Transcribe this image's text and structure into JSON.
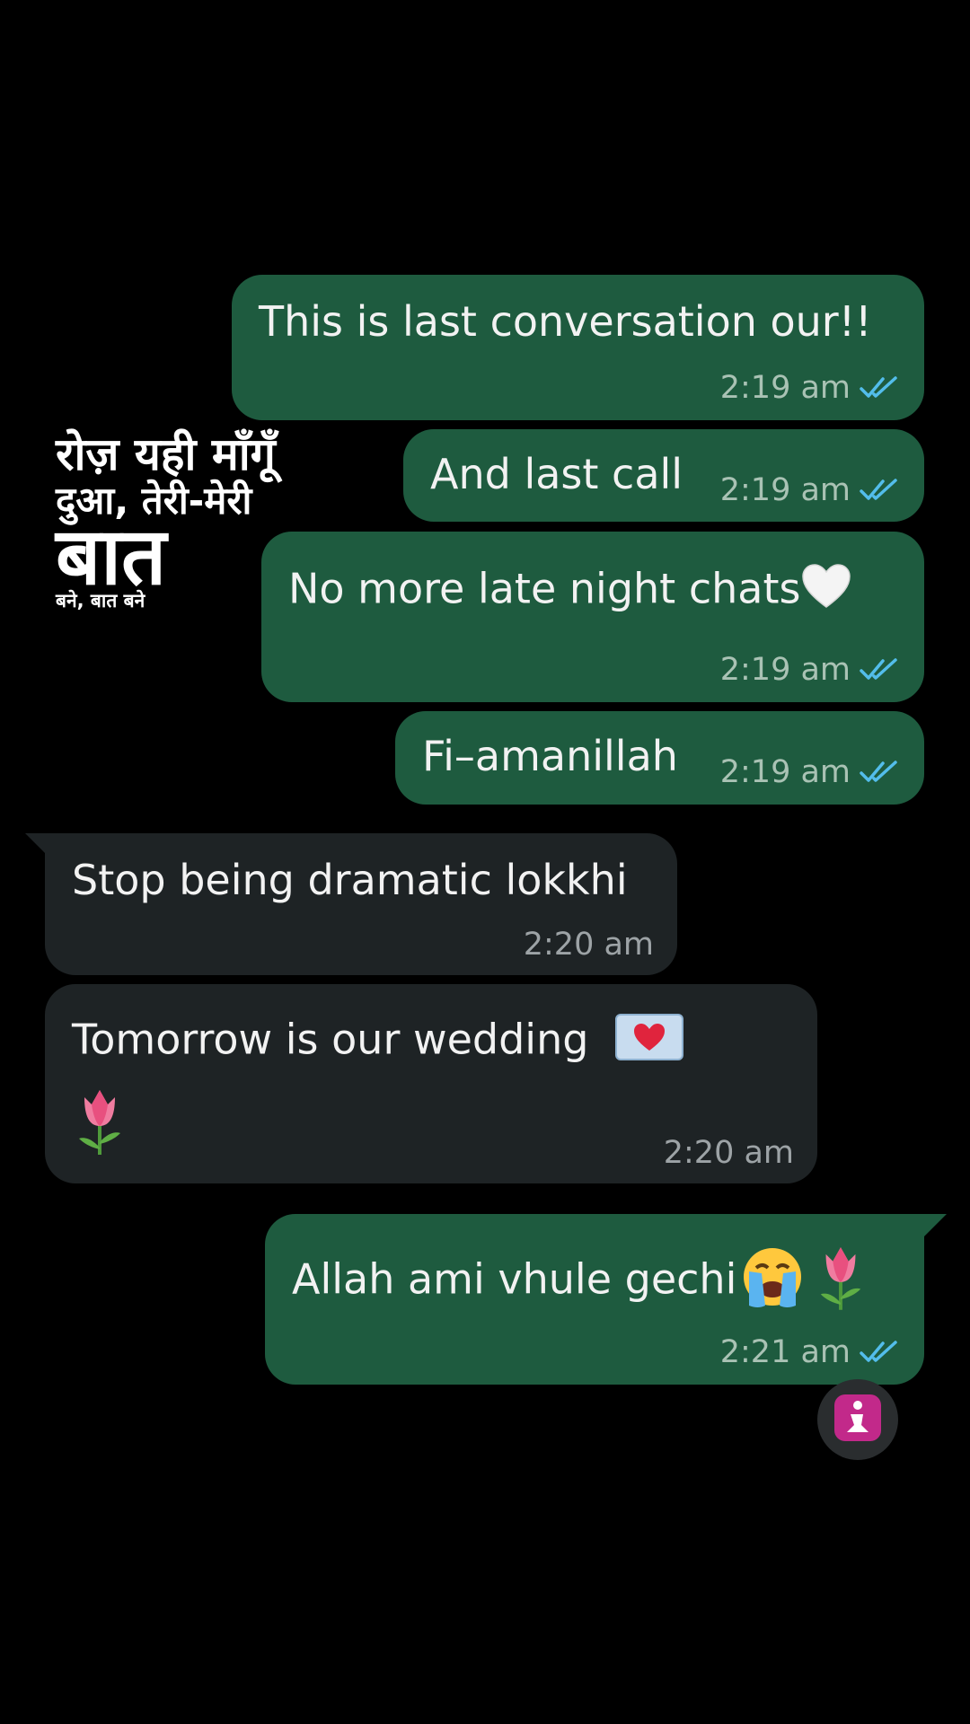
{
  "overlay": {
    "line1": "रोज़ यही माँगूँ",
    "line2": "दुआ, तेरी-मेरी",
    "line3": "बात",
    "line4": "बने, बात बने"
  },
  "messages": [
    {
      "direction": "outgoing",
      "text": "This is last conversation our!!",
      "time": "2:19 am",
      "read": true
    },
    {
      "direction": "outgoing",
      "text": "And last call",
      "time": "2:19 am",
      "read": true
    },
    {
      "direction": "outgoing",
      "text": "No more late night chats",
      "emoji": "white-heart",
      "time": "2:19 am",
      "read": true
    },
    {
      "direction": "outgoing",
      "text": "Fi–amanillah",
      "time": "2:19 am",
      "read": true
    },
    {
      "direction": "incoming",
      "text": "Stop being dramatic lokkhi",
      "time": "2:20 am"
    },
    {
      "direction": "incoming",
      "text": "Tomorrow is our wedding",
      "emoji": "love-letter, tulip",
      "time": "2:20 am"
    },
    {
      "direction": "outgoing",
      "text": "Allah ami vhule gechi",
      "emoji": "loudly-crying-face, tulip",
      "time": "2:21 am",
      "read": true
    }
  ],
  "colors": {
    "background": "#000000",
    "outgoing_bubble": "#1e5b3f",
    "incoming_bubble": "#1e2325",
    "read_tick": "#53bdeb"
  },
  "icons": {
    "read_receipt": "double-check-icon",
    "floating_button": "prayer-icon"
  }
}
